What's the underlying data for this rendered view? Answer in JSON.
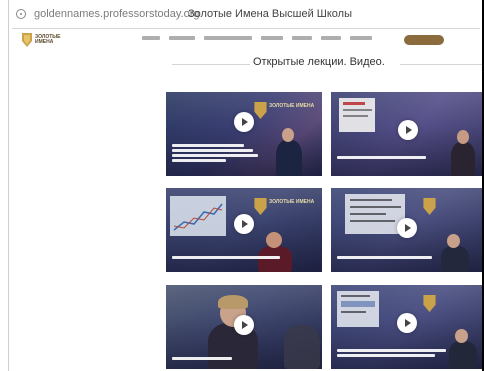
{
  "browser": {
    "url": "goldennames.professorstoday.org",
    "tab_title": "Золотые Имена Высшей Школы"
  },
  "header": {
    "logo_label": "ЗОЛОТЫЕ ИМЕНА",
    "nav_items": [
      "",
      "",
      "",
      "",
      "",
      "",
      ""
    ],
    "cta_label": ""
  },
  "main": {
    "section_title": "Открытые лекции. Видео."
  },
  "colors": {
    "accent_gold": "#c9a24a",
    "cta_brown": "#8b6a3e",
    "card_navy": "#2d3a63",
    "caption_white": "#ffffff"
  },
  "videos": [
    {
      "caption_lines": 4,
      "play_icon": "play-icon"
    },
    {
      "caption_lines": 1,
      "play_icon": "play-icon"
    },
    {
      "caption_lines": 1,
      "play_icon": "play-icon"
    },
    {
      "caption_lines": 1,
      "play_icon": "play-icon"
    },
    {
      "caption_lines": 1,
      "play_icon": "play-icon"
    },
    {
      "caption_lines": 2,
      "play_icon": "play-icon"
    }
  ]
}
